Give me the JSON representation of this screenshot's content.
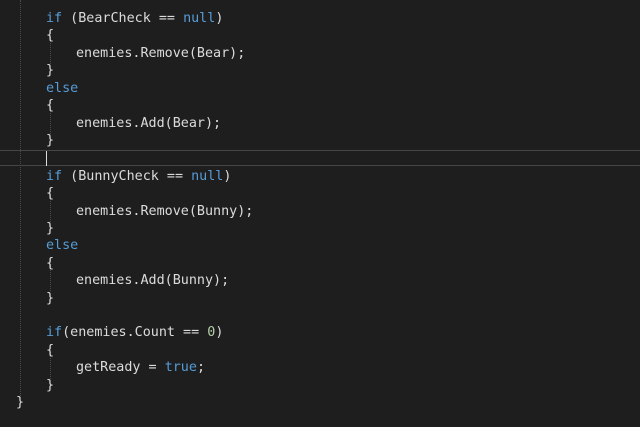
{
  "colors": {
    "background": "#1e1e1e",
    "text": "#dcdcdc",
    "keyword": "#569cd6",
    "number": "#b5cea8",
    "current_line_border": "#464646",
    "indent_guide": "#4a4a4a"
  },
  "editor": {
    "lines": [
      [
        {
          "t": "if",
          "c": "kw"
        },
        {
          "t": " (BearCheck == "
        },
        {
          "t": "null",
          "c": "kw"
        },
        {
          "t": ")"
        }
      ],
      [
        {
          "t": "{"
        }
      ],
      [
        {
          "t": "enemies.Remove(Bear);"
        }
      ],
      [
        {
          "t": "}"
        }
      ],
      [
        {
          "t": "else",
          "c": "kw"
        }
      ],
      [
        {
          "t": "{"
        }
      ],
      [
        {
          "t": "enemies.Add(Bear);"
        }
      ],
      [
        {
          "t": "}"
        }
      ],
      [],
      [
        {
          "t": "if",
          "c": "kw"
        },
        {
          "t": " (BunnyCheck == "
        },
        {
          "t": "null",
          "c": "kw"
        },
        {
          "t": ")"
        }
      ],
      [
        {
          "t": "{"
        }
      ],
      [
        {
          "t": "enemies.Remove(Bunny);"
        }
      ],
      [
        {
          "t": "}"
        }
      ],
      [
        {
          "t": "else",
          "c": "kw"
        }
      ],
      [
        {
          "t": "{"
        }
      ],
      [
        {
          "t": "enemies.Add(Bunny);"
        }
      ],
      [
        {
          "t": "}"
        }
      ],
      [],
      [
        {
          "t": "if",
          "c": "kw"
        },
        {
          "t": "(enemies.Count == "
        },
        {
          "t": "0",
          "c": "num"
        },
        {
          "t": ")"
        }
      ],
      [
        {
          "t": "{"
        }
      ],
      [
        {
          "t": "getReady = "
        },
        {
          "t": "true",
          "c": "kw"
        },
        {
          "t": ";"
        }
      ],
      [
        {
          "t": "}"
        }
      ],
      [
        {
          "t": "}"
        }
      ]
    ]
  }
}
